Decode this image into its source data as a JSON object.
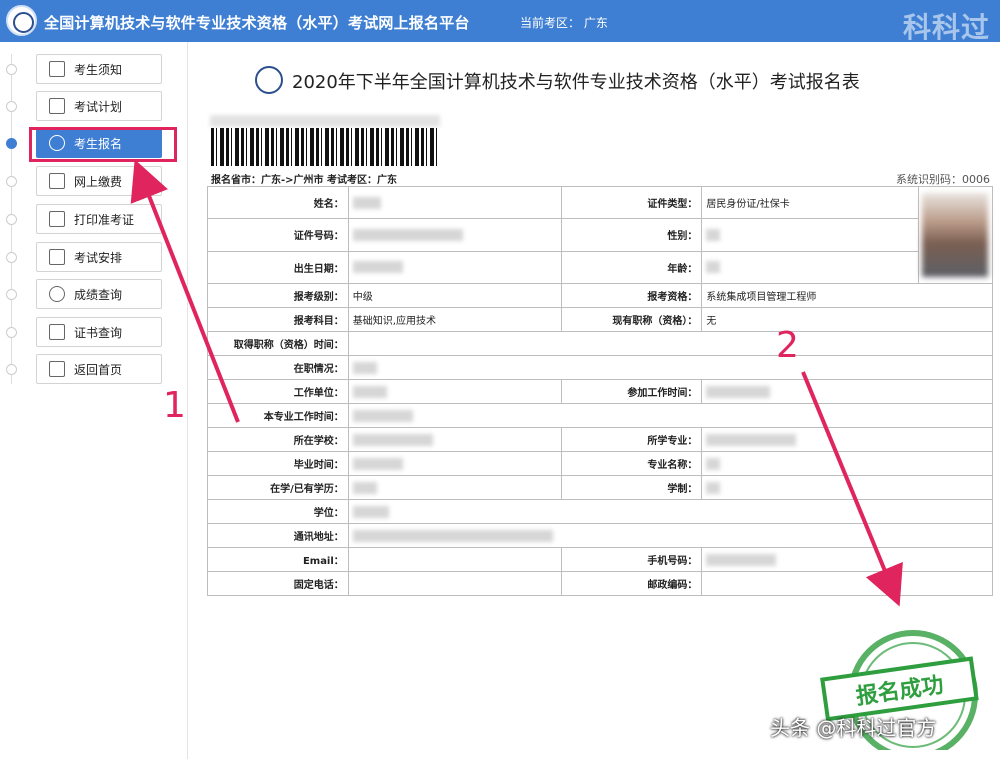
{
  "header": {
    "title": "全国计算机技术与软件专业技术资格（水平）考试网上报名平台",
    "region_label": "当前考区： 广东",
    "brand": "科科过"
  },
  "sidebar": {
    "items": [
      {
        "label": "考生须知",
        "active": false
      },
      {
        "label": "考试计划",
        "active": false
      },
      {
        "label": "考生报名",
        "active": true
      },
      {
        "label": "网上缴费",
        "active": false
      },
      {
        "label": "打印准考证",
        "active": false
      },
      {
        "label": "考试安排",
        "active": false
      },
      {
        "label": "成绩查询",
        "active": false
      },
      {
        "label": "证书查询",
        "active": false
      },
      {
        "label": "返回首页",
        "active": false
      }
    ]
  },
  "form": {
    "title": "2020年下半年全国计算机技术与软件专业技术资格（水平）考试报名表",
    "barcode_line": "报名省市：广东->广州市      考试考区：广东",
    "system_id": "系统识别码：0006",
    "rows": {
      "name": "姓名：",
      "id_type_label": "证件类型：",
      "id_type_value": "居民身份证/社保卡",
      "id_number": "证件号码：",
      "gender": "性别：",
      "birth": "出生日期：",
      "age": "年龄：",
      "level_label": "报考级别：",
      "level_value": "中级",
      "qualification_label": "报考资格：",
      "qualification_value": "系统集成项目管理工程师",
      "subject_label": "报考科目：",
      "subject_value": "基础知识,应用技术",
      "current_title_label": "现有职称（资格）：",
      "current_title_value": "无",
      "title_time": "取得职称（资格）时间：",
      "employment": "在职情况：",
      "employer": "工作单位：",
      "work_start": "参加工作时间：",
      "pro_work_time": "本专业工作时间：",
      "school": "所在学校：",
      "major": "所学专业：",
      "graduation": "毕业时间：",
      "major_name": "专业名称：",
      "education": "在学/已有学历：",
      "schooling": "学制：",
      "degree": "学位：",
      "address": "通讯地址：",
      "email": "Email：",
      "mobile": "手机号码：",
      "phone": "固定电话：",
      "postcode": "邮政编码："
    }
  },
  "annotations": {
    "one": "1",
    "two": "2"
  },
  "stamp": {
    "text": "报名成功"
  },
  "watermark": "头条 @科科过官方",
  "colors": {
    "header_blue": "#3f7fd3",
    "annotation_red": "#e0245e",
    "stamp_green": "#2e9e3e"
  }
}
